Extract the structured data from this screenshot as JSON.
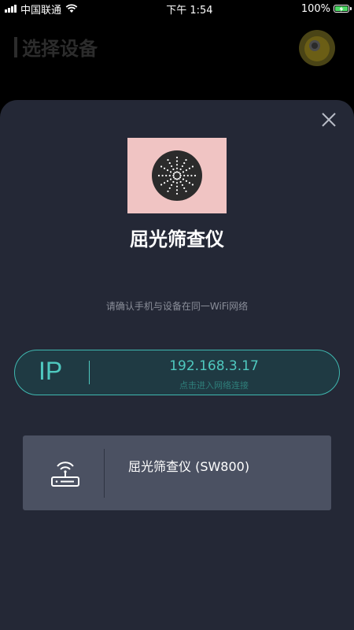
{
  "status_bar": {
    "carrier": "中国联通",
    "time": "下午 1:54",
    "battery": "100%",
    "battery_level": 1.0
  },
  "background": {
    "title": "选择设备"
  },
  "sheet": {
    "close_icon": "close-icon",
    "device_image_icon": "filter-wheel-icon",
    "device_title": "屈光筛查仪",
    "wifi_hint": "请确认手机与设备在同一WiFi网络",
    "ip": {
      "label": "IP",
      "address": "192.168.3.17",
      "subtitle": "点击进入网络连接"
    },
    "devices": [
      {
        "icon": "router-icon",
        "name": "屈光筛查仪 (SW800)"
      }
    ]
  },
  "colors": {
    "sheet_bg": "#242836",
    "accent": "#4fc9bf",
    "card_bg": "#4b5162",
    "image_bg": "#f0c4c3"
  }
}
